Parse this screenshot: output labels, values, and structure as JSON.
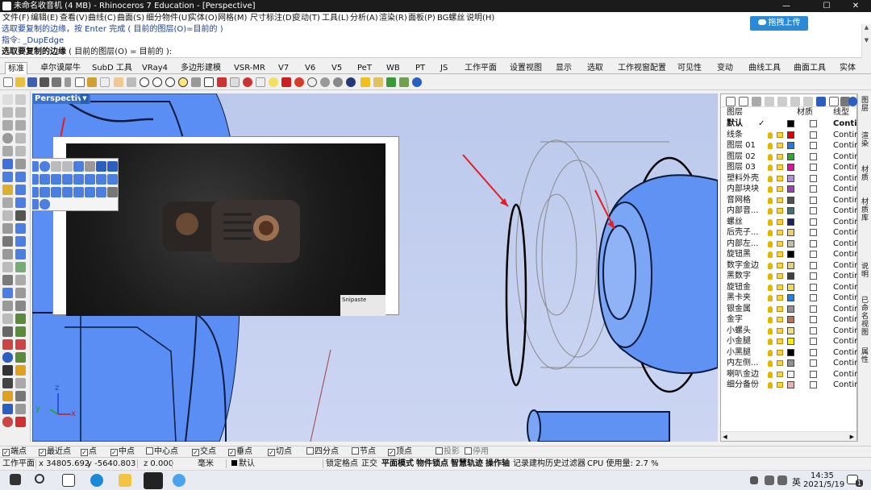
{
  "window": {
    "title": "未命名收音机 (4 MB) - Rhinoceros 7 Education - [Perspective]",
    "min": "—",
    "max": "☐",
    "close": "✕"
  },
  "menu": [
    "文件(F)",
    "编辑(E)",
    "查看(V)",
    "曲线(C)",
    "曲面(S)",
    "细分物件(U)",
    "实体(O)",
    "网格(M)",
    "尺寸标注(D)",
    "变动(T)",
    "工具(L)",
    "分析(A)",
    "渲染(R)",
    "面板(P)",
    "BG螺丝",
    "说明(H)"
  ],
  "command": {
    "line1": "选取要复制的边缘，按 Enter 完成 ( 目前的图层(O)=目前的 )",
    "line2": "指令: _DupEdge",
    "prompt_bold": "选取要复制的边缘",
    "prompt_rest": " ( 目前的图层(O) = 目前的 ):",
    "upload_button": "拖拽上传"
  },
  "tabs": [
    "标准",
    "卓尔谟犀牛",
    "SubD 工具",
    "VRay4",
    "多边形建模",
    "VSR-MR",
    "V7",
    "V6",
    "V5",
    "PeT",
    "WB",
    "PT",
    "JS",
    "工作平面",
    "设置视图",
    "显示",
    "选取",
    "工作视窗配置",
    "可见性",
    "变动",
    "曲线工具",
    "曲面工具",
    "实体"
  ],
  "viewport": {
    "label": "Perspective",
    "arrow": "▼",
    "axis_x": "x",
    "axis_y": "y",
    "axis_z": "z",
    "photo_watermark": "Snipaste"
  },
  "layers": {
    "headers": {
      "name": "图层",
      "material": "材质",
      "linetype": "线型"
    },
    "rows": [
      {
        "name": "默认",
        "color": "#000000",
        "linetype": "Conti",
        "current": true
      },
      {
        "name": "线条",
        "color": "#e00000",
        "linetype": "Contir"
      },
      {
        "name": "图层 01",
        "color": "#1a7fe0",
        "linetype": "Contir"
      },
      {
        "name": "图层 02",
        "color": "#22b022",
        "linetype": "Contir"
      },
      {
        "name": "图层 03",
        "color": "#e0109a",
        "linetype": "Contir"
      },
      {
        "name": "塑料外壳",
        "color": "#b090e0",
        "linetype": "Contir"
      },
      {
        "name": "内部块块",
        "color": "#a040c0",
        "linetype": "Contir"
      },
      {
        "name": "音网格",
        "color": "#505050",
        "linetype": "Contir"
      },
      {
        "name": "内部音...",
        "color": "#407080",
        "linetype": "Contir"
      },
      {
        "name": "螺丝",
        "color": "#202060",
        "linetype": "Contir"
      },
      {
        "name": "后壳子...",
        "color": "#f0d060",
        "linetype": "Contir"
      },
      {
        "name": "内部左...",
        "color": "#c0c0a0",
        "linetype": "Contir"
      },
      {
        "name": "旋钮黑",
        "color": "#000000",
        "linetype": "Contir"
      },
      {
        "name": "数字金边",
        "color": "#e0d080",
        "linetype": "Contir"
      },
      {
        "name": "黑数字",
        "color": "#404040",
        "linetype": "Contir"
      },
      {
        "name": "旋钮金",
        "color": "#f0e050",
        "linetype": "Contir"
      },
      {
        "name": "黑卡夹",
        "color": "#2080e0",
        "linetype": "Contir"
      },
      {
        "name": "银金属",
        "color": "#909090",
        "linetype": "Contir"
      },
      {
        "name": "金字",
        "color": "#c07050",
        "linetype": "Contir"
      },
      {
        "name": "小螺头",
        "color": "#f0e070",
        "linetype": "Contir"
      },
      {
        "name": "小金腿",
        "color": "#f8f000",
        "linetype": "Contir"
      },
      {
        "name": "小黑腿",
        "color": "#000000",
        "linetype": "Contir"
      },
      {
        "name": "内左侧...",
        "color": "#909090",
        "linetype": "Contir"
      },
      {
        "name": "喇叭金边",
        "color": "#f0f0f0",
        "linetype": "Contir"
      },
      {
        "name": "细分备份",
        "color": "#f0b0b0",
        "linetype": "Contir"
      }
    ]
  },
  "side_tabs": [
    "图层",
    "渲染",
    "材质",
    "材质库",
    "说明",
    "已命名视图",
    "属性"
  ],
  "snaps": [
    {
      "label": "端点",
      "checked": true
    },
    {
      "label": "最近点",
      "checked": true
    },
    {
      "label": "点",
      "checked": true
    },
    {
      "label": "中点",
      "checked": true
    },
    {
      "label": "中心点",
      "checked": false
    },
    {
      "label": "交点",
      "checked": true
    },
    {
      "label": "垂点",
      "checked": true
    },
    {
      "label": "切点",
      "checked": true
    },
    {
      "label": "四分点",
      "checked": false
    },
    {
      "label": "节点",
      "checked": false
    },
    {
      "label": "顶点",
      "checked": true
    },
    {
      "label": "投影",
      "checked": false
    },
    {
      "label": "停用",
      "checked": false
    }
  ],
  "status": {
    "cplane": "工作平面",
    "x": "x 34805.692",
    "y": "y -5640.803",
    "z": "z 0.000",
    "unit": "毫米",
    "layer": "默认",
    "items": [
      "锁定格点",
      "正交",
      "平面模式",
      "物件锁点",
      "智慧轨迹",
      "操作轴",
      "记录建构历史",
      "过滤器"
    ],
    "cpu": "CPU 使用量: 2.7 %"
  },
  "taskbar": {
    "time": "14:35",
    "date": "2021/5/19",
    "ime": "英",
    "notification": "1"
  },
  "colors": {
    "accent": "#3a72c8",
    "upload": "#2b8ad6",
    "viewport_bg": "#c5d0f0",
    "surface_blue": "#5a8ef5"
  }
}
